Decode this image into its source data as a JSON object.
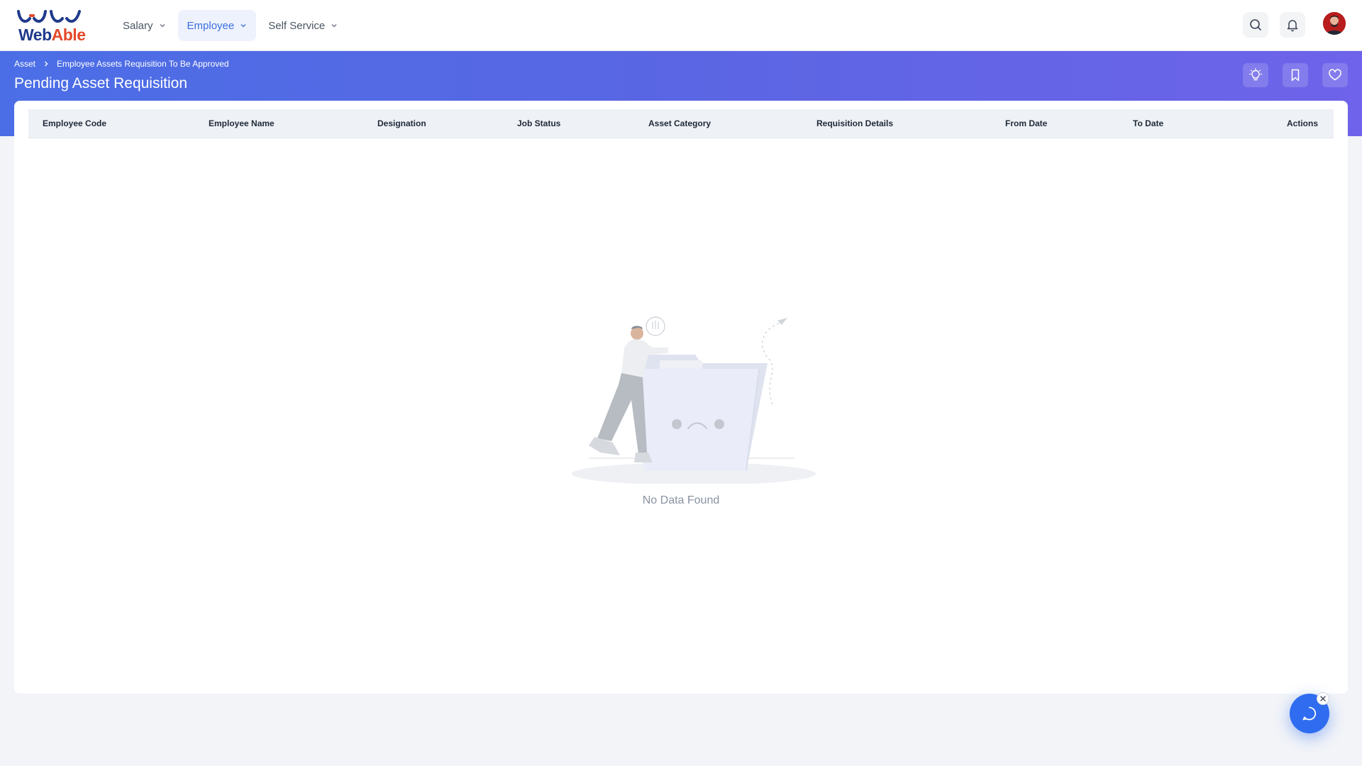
{
  "app": {
    "logo": {
      "text_part1": "Web",
      "text_part2": "Able"
    }
  },
  "nav": {
    "items": [
      {
        "label": "Salary",
        "active": false,
        "icon": "chevron-down-icon"
      },
      {
        "label": "Employee",
        "active": true,
        "icon": "chevron-down-icon"
      },
      {
        "label": "Self Service",
        "active": false,
        "icon": "chevron-down-icon"
      }
    ]
  },
  "topbar": {
    "icons": [
      "search-icon",
      "bell-icon",
      "avatar"
    ]
  },
  "header": {
    "breadcrumb": [
      "Asset",
      "Employee Assets Requisition To Be Approved"
    ],
    "title": "Pending Asset Requisition",
    "actions": [
      "bulb-icon",
      "bookmark-icon",
      "heart-icon"
    ]
  },
  "table": {
    "columns": [
      "Employee Code",
      "Employee Name",
      "Designation",
      "Job Status",
      "Asset Category",
      "Requisition Details",
      "From Date",
      "To Date",
      "Actions"
    ],
    "rows": [],
    "empty_text": "No Data Found"
  },
  "chat": {
    "icon": "chat-icon",
    "close_icon": "close-icon"
  },
  "colors": {
    "primary": "#3b6fe0",
    "header_gradient_start": "#4b6ee6",
    "header_gradient_end": "#6e63ea",
    "logo_blue": "#1e3a8a",
    "logo_red": "#e2482a",
    "chat_button": "#2f6cf0"
  }
}
